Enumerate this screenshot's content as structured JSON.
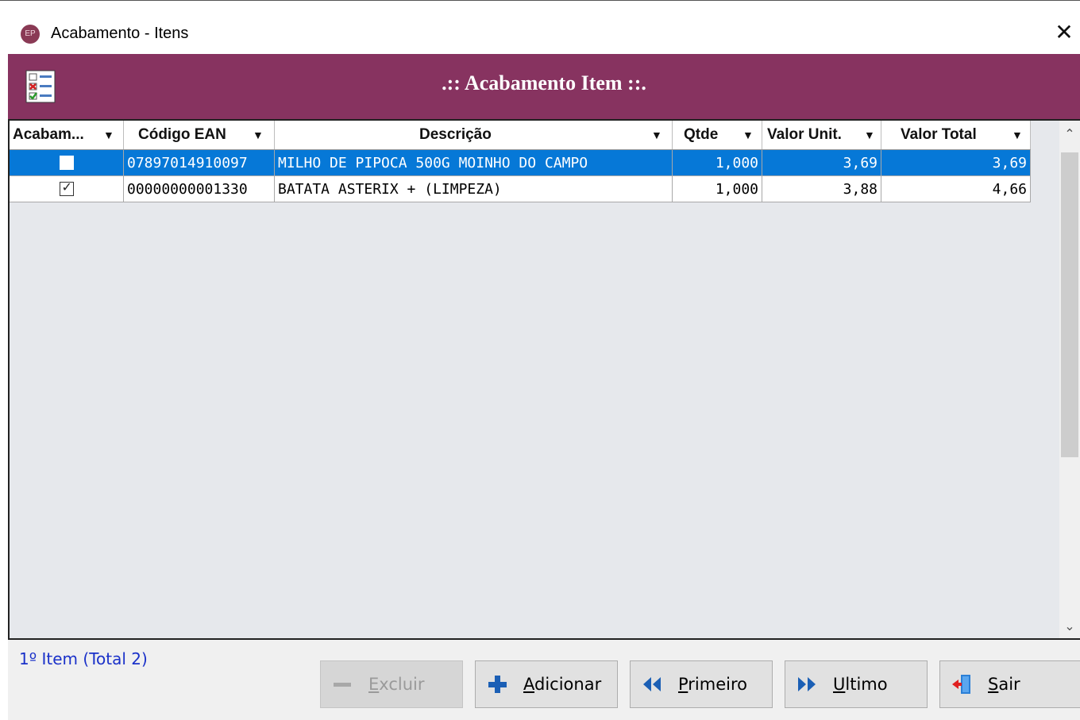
{
  "window": {
    "title": "Acabamento - Itens",
    "app_icon": "EP"
  },
  "banner": {
    "title": ".:: Acabamento Item ::."
  },
  "grid": {
    "columns": [
      {
        "label": "Acabam...",
        "width": 144
      },
      {
        "label": "Código EAN",
        "width": 190
      },
      {
        "label": "Descrição",
        "width": 501
      },
      {
        "label": "Qtde",
        "width": 113
      },
      {
        "label": "Valor Unit.",
        "width": 150
      },
      {
        "label": "Valor Total",
        "width": 188
      }
    ],
    "rows": [
      {
        "checked": false,
        "ean": "07897014910097",
        "descricao": "MILHO DE PIPOCA 500G MOINHO DO CAMPO",
        "qtde": "1,000",
        "valor_unit": "3,69",
        "valor_total": "3,69",
        "selected": true
      },
      {
        "checked": true,
        "ean": "00000000001330",
        "descricao": "BATATA ASTERIX + (LIMPEZA)",
        "qtde": "1,000",
        "valor_unit": "3,88",
        "valor_total": "4,66",
        "selected": false
      }
    ]
  },
  "status": "1º Item (Total 2)",
  "buttons": {
    "excluir": {
      "label": "Excluir",
      "underline": "E",
      "rest": "xcluir",
      "enabled": false
    },
    "adicionar": {
      "label": "Adicionar",
      "underline": "A",
      "rest": "dicionar"
    },
    "primeiro": {
      "label": "Primeiro",
      "underline": "P",
      "rest": "rimeiro"
    },
    "ultimo": {
      "label": "Ultimo",
      "underline": "U",
      "rest": "ltimo"
    },
    "sair": {
      "label": "Sair",
      "underline": "S",
      "rest": "air"
    }
  },
  "colors": {
    "banner": "#873360",
    "selected_row": "#0678d7",
    "status_text": "#1a31c9"
  }
}
